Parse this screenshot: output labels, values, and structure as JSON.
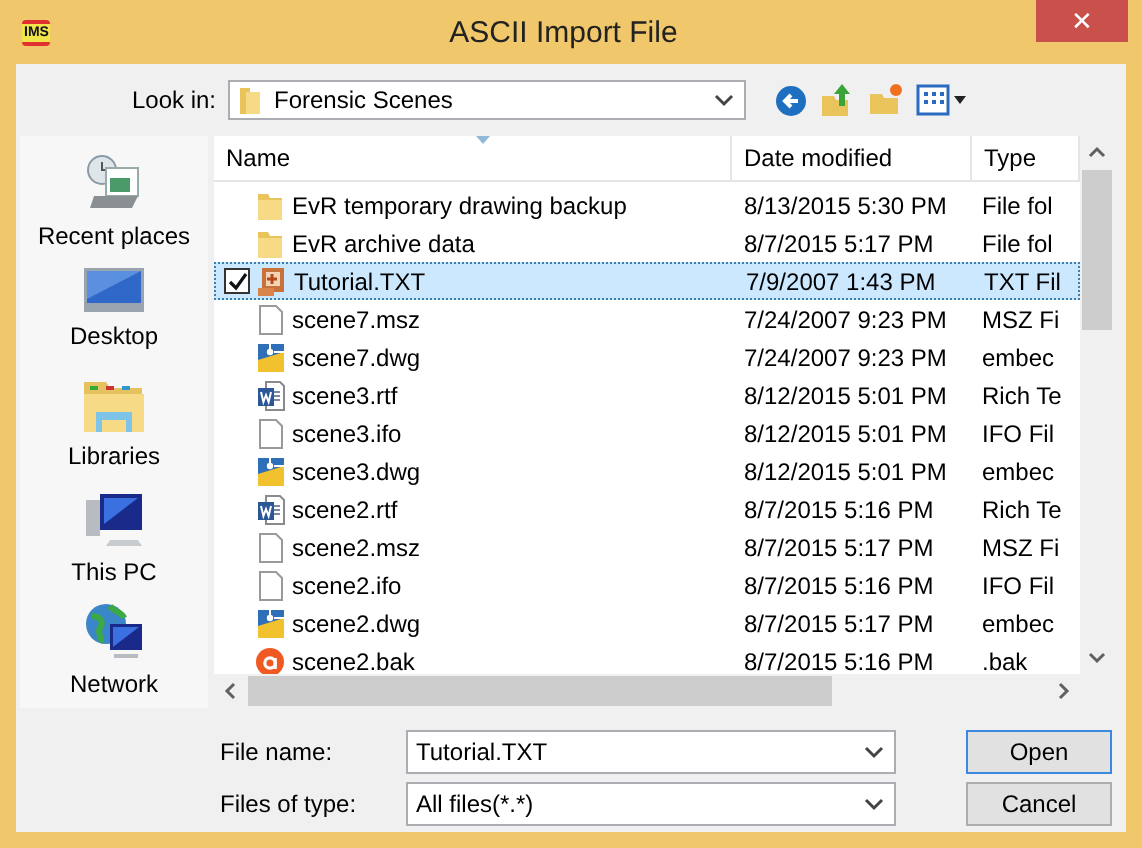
{
  "window": {
    "title": "ASCII Import File",
    "app_badge": "IMS",
    "close": "✕"
  },
  "look_in": {
    "label": "Look in:",
    "value": "Forensic Scenes"
  },
  "sidebar": {
    "items": [
      {
        "label": "Recent places",
        "kind": "recent"
      },
      {
        "label": "Desktop",
        "kind": "desktop"
      },
      {
        "label": "Libraries",
        "kind": "libraries"
      },
      {
        "label": "This PC",
        "kind": "pc"
      },
      {
        "label": "Network",
        "kind": "network"
      }
    ]
  },
  "table": {
    "columns": [
      "Name",
      "Date modified",
      "Type"
    ],
    "rows": [
      {
        "name": "EvR temporary drawing backup",
        "date": "8/13/2015 5:30 PM",
        "type": "File fol",
        "kind": "folder",
        "selected": false,
        "checked": false
      },
      {
        "name": "EvR archive data",
        "date": "8/7/2015 5:17 PM",
        "type": "File fol",
        "kind": "folder",
        "selected": false,
        "checked": false
      },
      {
        "name": "Tutorial.TXT",
        "date": "7/9/2007 1:43 PM",
        "type": "TXT Fil",
        "kind": "app",
        "selected": true,
        "checked": true
      },
      {
        "name": "scene7.msz",
        "date": "7/24/2007 9:23 PM",
        "type": "MSZ Fi",
        "kind": "blank",
        "selected": false,
        "checked": false
      },
      {
        "name": "scene7.dwg",
        "date": "7/24/2007 9:23 PM",
        "type": "embec",
        "kind": "dwg",
        "selected": false,
        "checked": false
      },
      {
        "name": "scene3.rtf",
        "date": "8/12/2015 5:01 PM",
        "type": "Rich Te",
        "kind": "word",
        "selected": false,
        "checked": false
      },
      {
        "name": "scene3.ifo",
        "date": "8/12/2015 5:01 PM",
        "type": "IFO Fil",
        "kind": "blank",
        "selected": false,
        "checked": false
      },
      {
        "name": "scene3.dwg",
        "date": "8/12/2015 5:01 PM",
        "type": "embec",
        "kind": "dwg",
        "selected": false,
        "checked": false
      },
      {
        "name": "scene2.rtf",
        "date": "8/7/2015 5:16 PM",
        "type": "Rich Te",
        "kind": "word",
        "selected": false,
        "checked": false
      },
      {
        "name": "scene2.msz",
        "date": "8/7/2015 5:17 PM",
        "type": "MSZ Fi",
        "kind": "blank",
        "selected": false,
        "checked": false
      },
      {
        "name": "scene2.ifo",
        "date": "8/7/2015 5:16 PM",
        "type": "IFO Fil",
        "kind": "blank",
        "selected": false,
        "checked": false
      },
      {
        "name": "scene2.dwg",
        "date": "8/7/2015 5:17 PM",
        "type": "embec",
        "kind": "dwg",
        "selected": false,
        "checked": false
      },
      {
        "name": "scene2.bak",
        "date": "8/7/2015 5:16 PM",
        "type": ".bak",
        "kind": "bak",
        "selected": false,
        "checked": false
      }
    ]
  },
  "file_name": {
    "label": "File name:",
    "value": "Tutorial.TXT"
  },
  "file_type": {
    "label": "Files of type:",
    "value": "All files(*.*)"
  },
  "buttons": [
    {
      "label": "Open",
      "default": true
    },
    {
      "label": "Cancel",
      "default": false
    }
  ]
}
